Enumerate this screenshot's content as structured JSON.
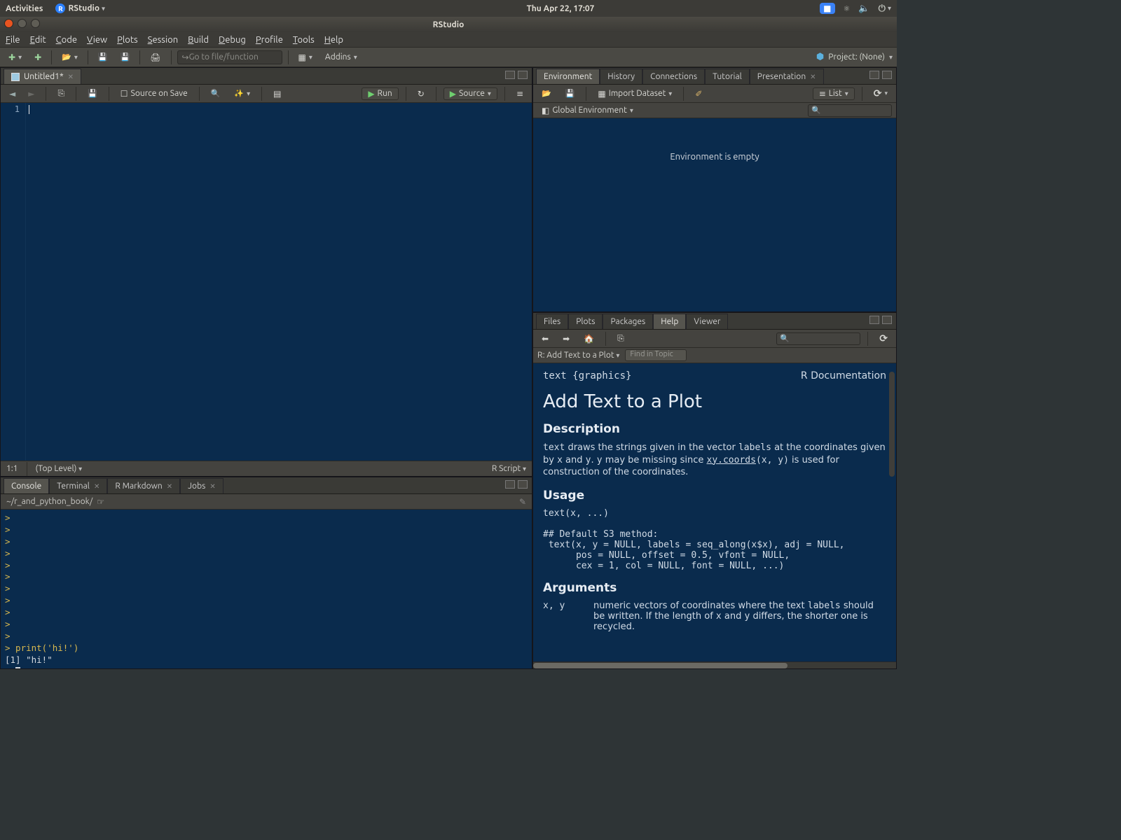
{
  "os": {
    "activities": "Activities",
    "app_name": "RStudio",
    "clock": "Thu Apr 22, 17:07"
  },
  "window": {
    "title": "RStudio"
  },
  "menubar": [
    "File",
    "Edit",
    "Code",
    "View",
    "Plots",
    "Session",
    "Build",
    "Debug",
    "Profile",
    "Tools",
    "Help"
  ],
  "toolbar": {
    "goto_placeholder": "Go to file/function",
    "addins": "Addins",
    "project": "Project: (None)"
  },
  "editor": {
    "tab": "Untitled1*",
    "source_on_save": "Source on Save",
    "run": "Run",
    "source": "Source",
    "line_number": "1",
    "status_pos": "1:1",
    "status_scope": "(Top Level)",
    "status_type": "R Script"
  },
  "console": {
    "tabs": [
      "Console",
      "Terminal",
      "R Markdown",
      "Jobs"
    ],
    "wd": "~/r_and_python_book/",
    "lines": [
      {
        "t": "prompt",
        "v": ">"
      },
      {
        "t": "prompt",
        "v": ">"
      },
      {
        "t": "prompt",
        "v": ">"
      },
      {
        "t": "prompt",
        "v": ">"
      },
      {
        "t": "prompt",
        "v": ">"
      },
      {
        "t": "prompt",
        "v": ">"
      },
      {
        "t": "prompt",
        "v": ">"
      },
      {
        "t": "prompt",
        "v": ">"
      },
      {
        "t": "prompt",
        "v": ">"
      },
      {
        "t": "prompt",
        "v": ">"
      },
      {
        "t": "prompt",
        "v": ">"
      },
      {
        "t": "cmd",
        "v": "> print('hi!')"
      },
      {
        "t": "output",
        "v": "[1] \"hi!\""
      },
      {
        "t": "input",
        "v": "> "
      }
    ]
  },
  "env": {
    "tabs": [
      "Environment",
      "History",
      "Connections",
      "Tutorial",
      "Presentation"
    ],
    "import": "Import Dataset",
    "view": "List",
    "scope": "Global Environment",
    "empty": "Environment is empty"
  },
  "help": {
    "tabs": [
      "Files",
      "Plots",
      "Packages",
      "Help",
      "Viewer"
    ],
    "breadcrumb": "R: Add Text to a Plot",
    "find_placeholder": "Find in Topic",
    "page": {
      "left_hdr": "text {graphics}",
      "right_hdr": "R Documentation",
      "title": "Add Text to a Plot",
      "desc_h": "Description",
      "desc1a": "text",
      "desc1b": " draws the strings given in the vector ",
      "desc1c": "labels",
      "desc1d": " at the coordinates given by ",
      "desc1e": "x",
      "desc1f": " and ",
      "desc1g": "y",
      "desc1h": ". ",
      "desc1i": "y",
      "desc1j": " may be missing since ",
      "desc1k": "xy.coords",
      "desc1l": "(x, y)",
      "desc1m": " is used for construction of the coordinates.",
      "usage_h": "Usage",
      "usage_code": "text(x, ...)\n\n## Default S3 method:\n text(x, y = NULL, labels = seq_along(x$x), adj = NULL,\n      pos = NULL, offset = 0.5, vfont = NULL,\n      cex = 1, col = NULL, font = NULL, ...)",
      "args_h": "Arguments",
      "arg1_n": "x, y",
      "arg1_d_a": "numeric vectors of coordinates where the text ",
      "arg1_d_b": "labels",
      "arg1_d_c": " should be written. If the length of ",
      "arg1_d_d": "x",
      "arg1_d_e": " and ",
      "arg1_d_f": "y",
      "arg1_d_g": " differs, the shorter one is recycled."
    }
  }
}
